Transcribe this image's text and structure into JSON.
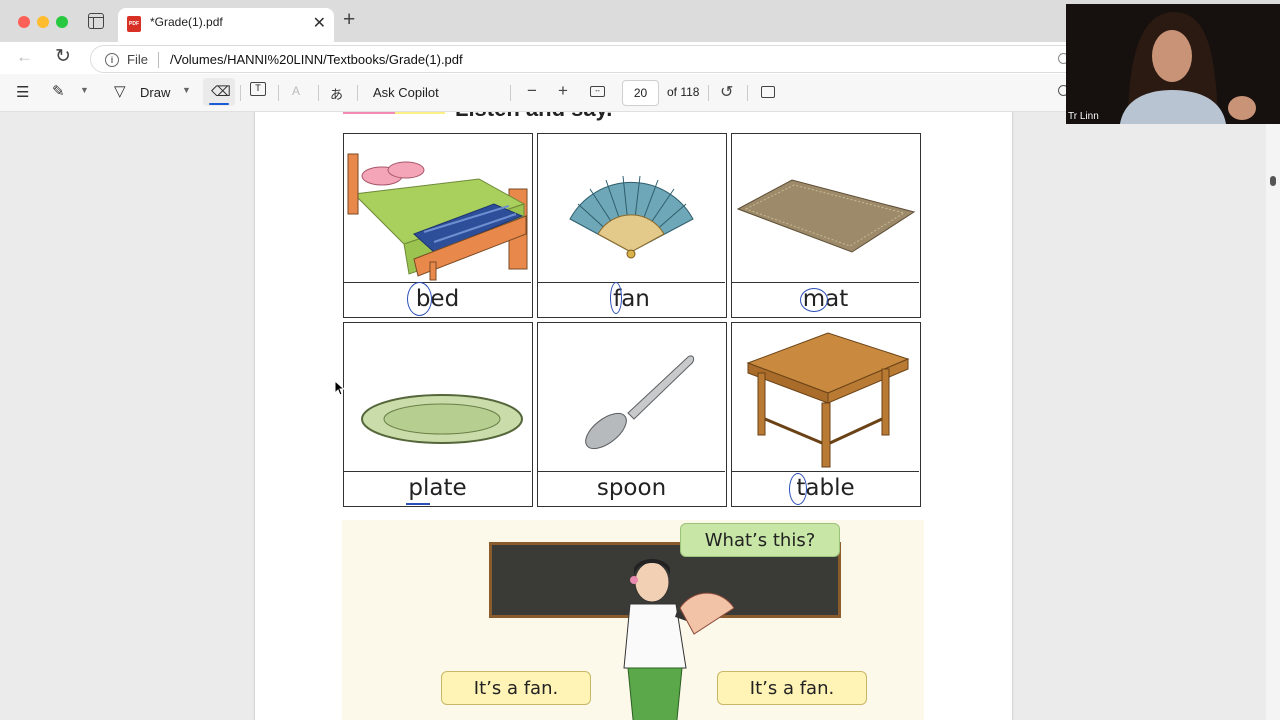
{
  "browser": {
    "tab": {
      "title": "*Grade(1).pdf",
      "close_glyph": "✕",
      "icon": "pdf-icon"
    },
    "new_tab_glyph": "+",
    "address": {
      "scheme_label": "File",
      "url": "/Volumes/HANNI%20LINN/Textbooks/Grade(1).pdf"
    }
  },
  "pdf_toolbar": {
    "draw_label": "Draw",
    "copilot_label": "Ask Copilot",
    "translate_glyph": "あ",
    "readaloud_glyph": "A",
    "zoom_out_glyph": "−",
    "zoom_in_glyph": "+",
    "page_current": "20",
    "page_total": "of 118"
  },
  "page": {
    "section_heading": "Listen and say.",
    "vocabulary": [
      {
        "word": "bed"
      },
      {
        "word": "fan"
      },
      {
        "word": "mat"
      },
      {
        "word": "plate"
      },
      {
        "word": "spoon"
      },
      {
        "word": "table"
      }
    ],
    "dialogue": {
      "question": "What’s this?",
      "answer_left": "It’s a fan.",
      "answer_right": "It’s a fan."
    }
  },
  "webcam": {
    "name": "Tr Linn"
  },
  "colors": {
    "annotation_ink": "#2a4fb8",
    "bubble_question": "#c8e6a6",
    "bubble_answer": "#fff4b6"
  }
}
